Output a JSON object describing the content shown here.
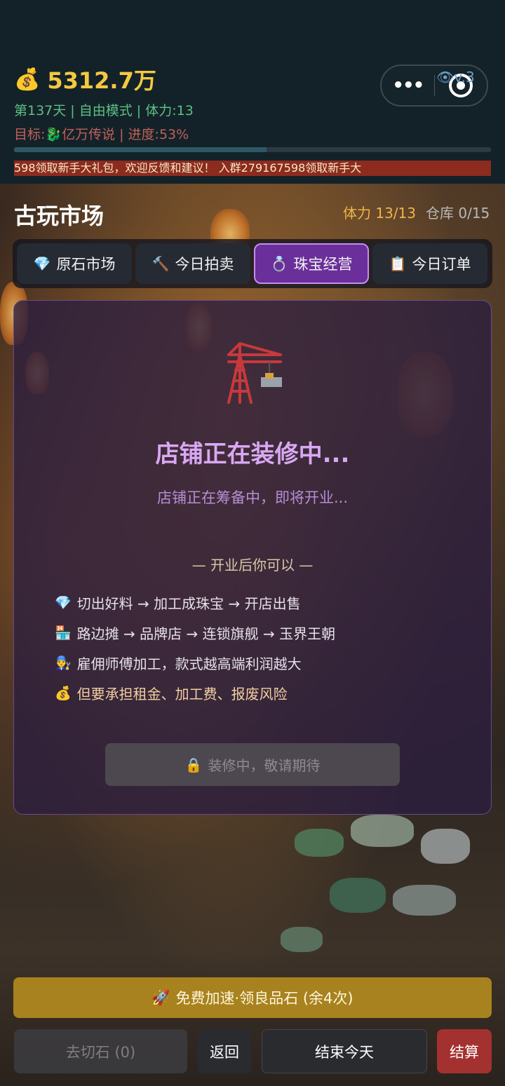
{
  "header": {
    "money_icon": "💰",
    "money": "5312.7万",
    "status_line": "第137天 | 自由模式 | 体力:13",
    "goal_prefix": "目标:",
    "goal_icon": "🐉",
    "goal_suffix": "亿万传说 | 进度:53%",
    "progress_percent": 53,
    "ticker": "598领取新手大礼包，欢迎反馈和建议！      入群279167598领取新手大",
    "capsule_more": "•••",
    "eye_badge": "👁v.3"
  },
  "market": {
    "title": "古玩市场",
    "stamina": "体力 13/13",
    "storage": "仓库 0/15"
  },
  "tabs": [
    {
      "icon": "💎",
      "label": "原石市场",
      "active": false
    },
    {
      "icon": "🔨",
      "label": "今日拍卖",
      "active": false
    },
    {
      "icon": "💍",
      "label": "珠宝经营",
      "active": true
    },
    {
      "icon": "📋",
      "label": "今日订单",
      "active": false
    }
  ],
  "panel": {
    "heading": "店铺正在装修中...",
    "subtitle": "店铺正在筹备中，即将开业...",
    "after_open": "— 开业后你可以 —",
    "features": [
      {
        "icon": "💎",
        "text": "切出好料 → 加工成珠宝 → 开店出售"
      },
      {
        "icon": "🏪",
        "text": "路边摊 → 品牌店 → 连锁旗舰 → 玉界王朝"
      },
      {
        "icon": "👨‍🔧",
        "text": "雇佣师傅加工，款式越高端利润越大"
      },
      {
        "icon": "💰",
        "text": "但要承担租金、加工费、报废风险"
      }
    ],
    "disabled_button_icon": "🔒",
    "disabled_button": "装修中，敬请期待"
  },
  "bottom": {
    "boost_icon": "🚀",
    "boost": "免费加速·领良品石 (余4次)",
    "cut": "去切石 (0)",
    "back": "返回",
    "end_day": "结束今天",
    "settle": "结算"
  },
  "colors": {
    "accent_gold": "#f5c842",
    "tab_active": "#6a2f9a",
    "settle_red": "#a23130",
    "boost_gold": "#a8821e"
  }
}
